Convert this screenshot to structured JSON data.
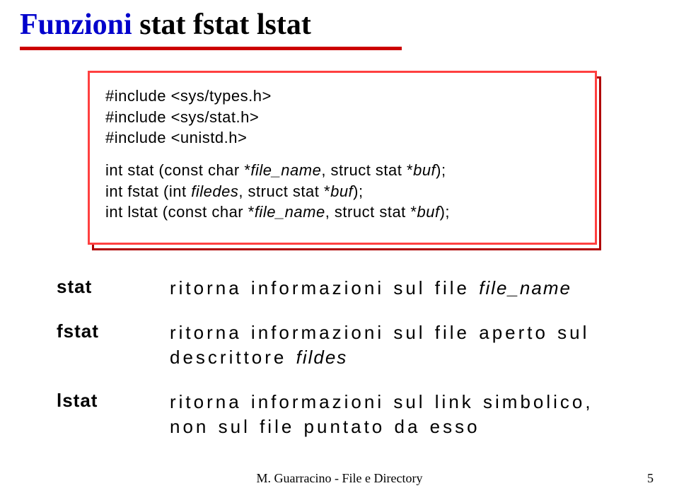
{
  "title": {
    "part1": "Funzioni",
    "part2": "stat fstat lstat"
  },
  "codebox": {
    "inc1": "#include <sys/types.h>",
    "inc2": "#include <sys/stat.h>",
    "inc3": "#include <unistd.h>",
    "l1a": "int stat (const char *",
    "l1b": "file_name",
    "l1c": ", struct stat *",
    "l1d": "buf",
    "l1e": ");",
    "l2a": "int fstat (int ",
    "l2b": "filedes",
    "l2c": ", struct stat *",
    "l2d": "buf",
    "l2e": ");",
    "l3a": "int lstat (const char *",
    "l3b": "file_name",
    "l3c": ", struct stat *",
    "l3d": "buf",
    "l3e": ");"
  },
  "defs": {
    "stat": {
      "term": "stat",
      "desc_a": "ritorna informazioni sul file ",
      "desc_b": "file_name"
    },
    "fstat": {
      "term": "fstat",
      "desc_a": "ritorna informazioni sul file aperto sul descrittore ",
      "desc_b": "fildes"
    },
    "lstat": {
      "term": "lstat",
      "desc": "ritorna informazioni sul link simbolico, non sul file puntato da esso"
    }
  },
  "footer": "M. Guarracino - File e Directory",
  "page": "5"
}
